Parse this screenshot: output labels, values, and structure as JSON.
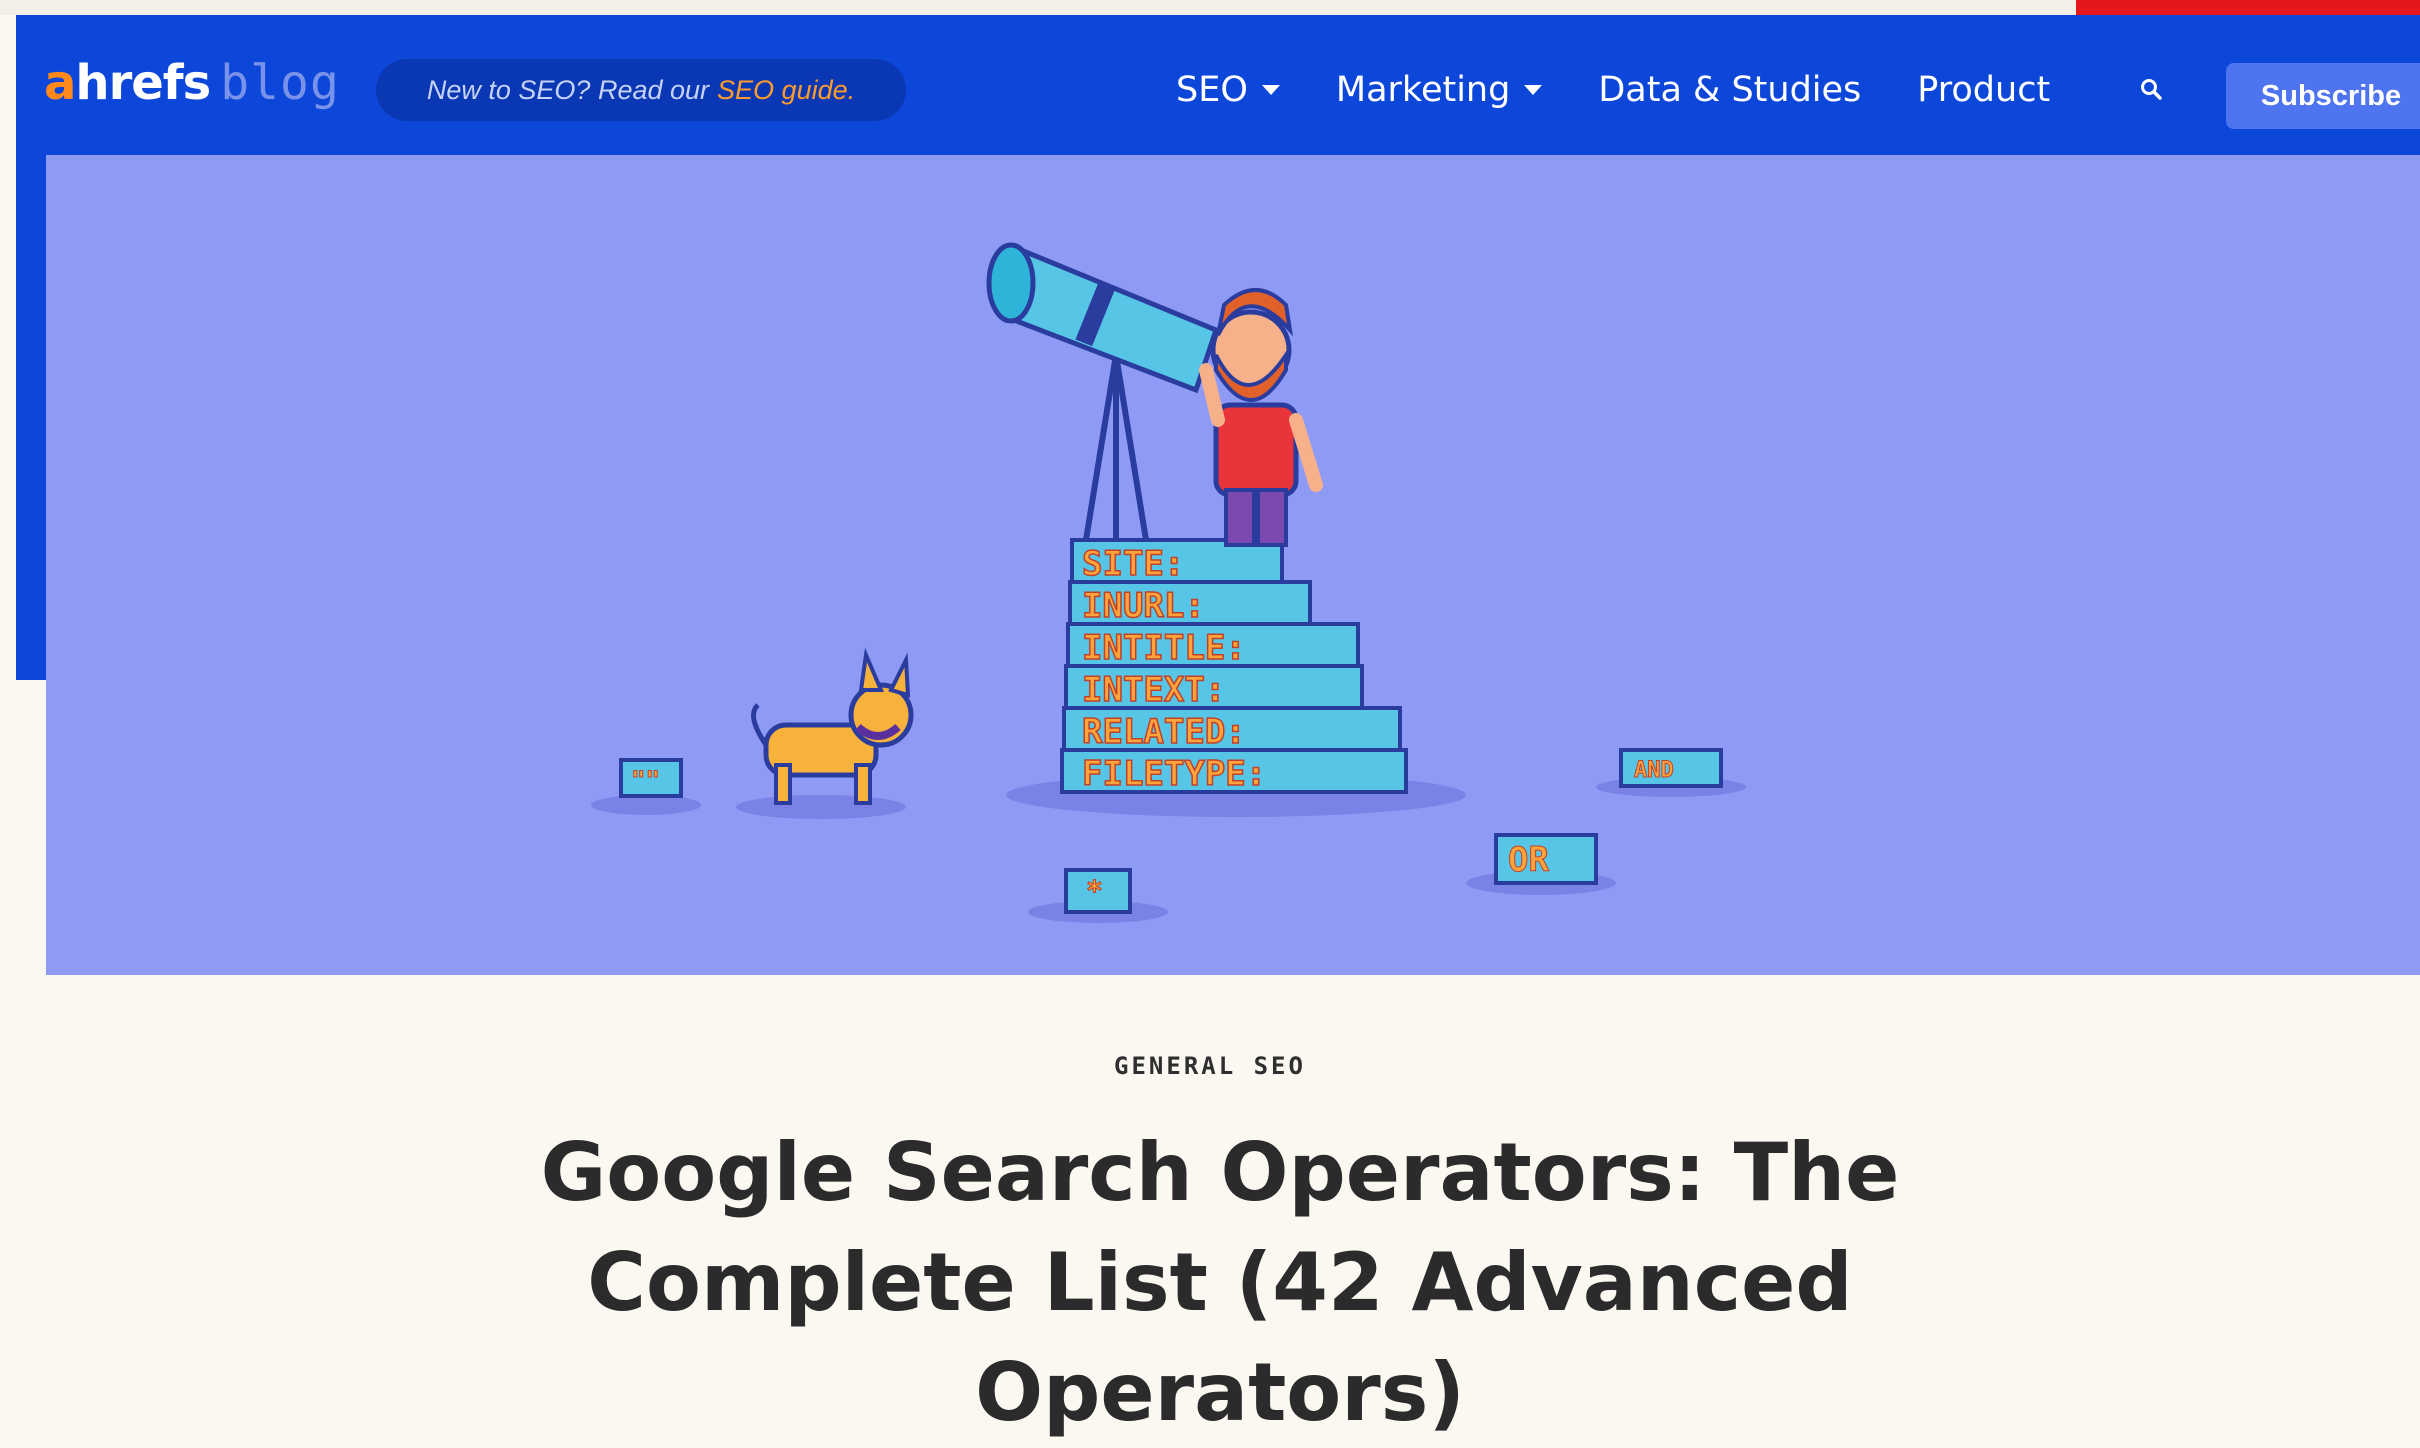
{
  "navbar": {
    "logo_a": "a",
    "logo_rest": "hrefs",
    "logo_blog": "blog",
    "promo_text": "New to SEO? Read our",
    "promo_link": "SEO guide.",
    "items": [
      {
        "label": "SEO",
        "dropdown": true
      },
      {
        "label": "Marketing",
        "dropdown": true
      },
      {
        "label": "Data & Studies",
        "dropdown": false
      },
      {
        "label": "Product",
        "dropdown": false
      }
    ],
    "search_icon": "search-icon",
    "subscribe_label": "Subscribe"
  },
  "hero": {
    "illustration": "telescope-man-on-operator-blocks",
    "blocks": [
      "SITE:",
      "INURL:",
      "INTITLE:",
      "INTEXT:",
      "RELATED:",
      "FILETYPE:"
    ],
    "small_blocks": [
      "\"\"",
      "AND",
      "OR",
      "*"
    ]
  },
  "article": {
    "category": "GENERAL SEO",
    "title": "Google Search Operators: The Complete List (42 Advanced Operators)"
  },
  "colors": {
    "nav_bg": "#0d47d9",
    "hero_bg": "#8f9af5",
    "accent_orange": "#ff8a1a",
    "subscribe_bg": "#4e74f0",
    "red_bar": "#e3171c"
  }
}
